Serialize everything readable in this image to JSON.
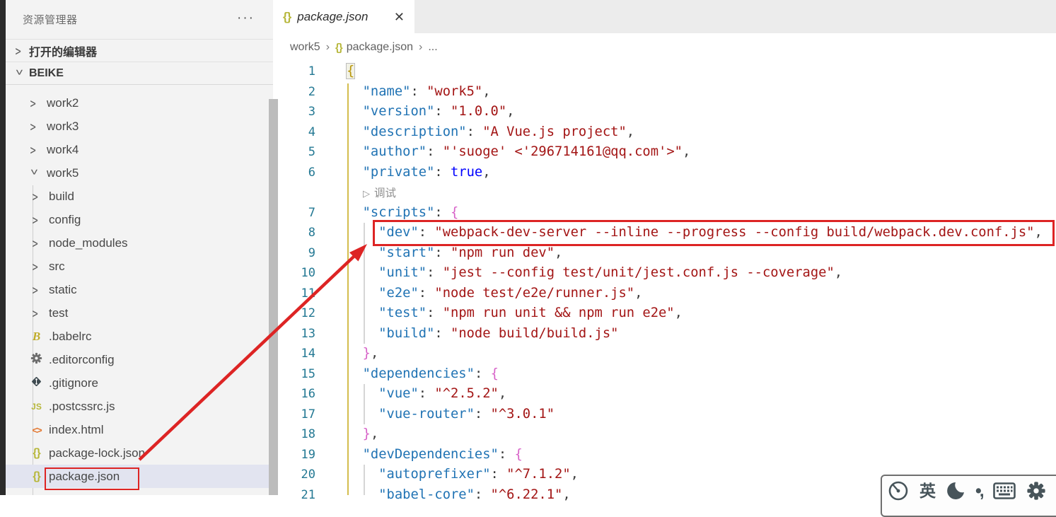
{
  "sidebar": {
    "title": "资源管理器",
    "more_actions": "···",
    "sections": [
      {
        "label": "打开的编辑器",
        "expanded": false
      },
      {
        "label": "BEIKE",
        "expanded": true
      }
    ],
    "tree": [
      {
        "label": "work2",
        "kind": "folder",
        "level": 1,
        "expanded": false
      },
      {
        "label": "work3",
        "kind": "folder",
        "level": 1,
        "expanded": false
      },
      {
        "label": "work4",
        "kind": "folder",
        "level": 1,
        "expanded": false
      },
      {
        "label": "work5",
        "kind": "folder",
        "level": 1,
        "expanded": true
      },
      {
        "label": "build",
        "kind": "folder",
        "level": 2,
        "expanded": false
      },
      {
        "label": "config",
        "kind": "folder",
        "level": 2,
        "expanded": false
      },
      {
        "label": "node_modules",
        "kind": "folder",
        "level": 2,
        "expanded": false
      },
      {
        "label": "src",
        "kind": "folder",
        "level": 2,
        "expanded": false
      },
      {
        "label": "static",
        "kind": "folder",
        "level": 2,
        "expanded": false
      },
      {
        "label": "test",
        "kind": "folder",
        "level": 2,
        "expanded": false
      },
      {
        "label": ".babelrc",
        "kind": "file",
        "icon": "babel-icon",
        "level": 2
      },
      {
        "label": ".editorconfig",
        "kind": "file",
        "icon": "gear-file-icon",
        "level": 2
      },
      {
        "label": ".gitignore",
        "kind": "file",
        "icon": "git-icon",
        "level": 2
      },
      {
        "label": ".postcssrc.js",
        "kind": "file",
        "icon": "js-icon",
        "level": 2
      },
      {
        "label": "index.html",
        "kind": "file",
        "icon": "html-icon",
        "level": 2
      },
      {
        "label": "package-lock.json",
        "kind": "file",
        "icon": "json-icon",
        "level": 2
      },
      {
        "label": "package.json",
        "kind": "file",
        "icon": "json-icon",
        "level": 2,
        "selected": true,
        "annotated": true
      }
    ]
  },
  "editor": {
    "tab": {
      "label": "package.json",
      "close_glyph": "✕"
    },
    "breadcrumb": {
      "root": "work5",
      "file": "package.json",
      "more": "...",
      "separator": "›"
    },
    "codelens": {
      "glyph": "▷",
      "label": "调试"
    },
    "code_lines": [
      {
        "num": "1",
        "tokens": [
          {
            "t": "b1",
            "v": "{",
            "match": true
          }
        ]
      },
      {
        "num": "2",
        "tokens": [
          {
            "t": "ws",
            "v": "  "
          },
          {
            "t": "k",
            "v": "\"name\""
          },
          {
            "t": "p",
            "v": ": "
          },
          {
            "t": "s",
            "v": "\"work5\""
          },
          {
            "t": "p",
            "v": ","
          }
        ]
      },
      {
        "num": "3",
        "tokens": [
          {
            "t": "ws",
            "v": "  "
          },
          {
            "t": "k",
            "v": "\"version\""
          },
          {
            "t": "p",
            "v": ": "
          },
          {
            "t": "s",
            "v": "\"1.0.0\""
          },
          {
            "t": "p",
            "v": ","
          }
        ]
      },
      {
        "num": "4",
        "tokens": [
          {
            "t": "ws",
            "v": "  "
          },
          {
            "t": "k",
            "v": "\"description\""
          },
          {
            "t": "p",
            "v": ": "
          },
          {
            "t": "s",
            "v": "\"A Vue.js project\""
          },
          {
            "t": "p",
            "v": ","
          }
        ]
      },
      {
        "num": "5",
        "tokens": [
          {
            "t": "ws",
            "v": "  "
          },
          {
            "t": "k",
            "v": "\"author\""
          },
          {
            "t": "p",
            "v": ": "
          },
          {
            "t": "s",
            "v": "\"'suoge' <'296714161@qq.com'>\""
          },
          {
            "t": "p",
            "v": ","
          }
        ]
      },
      {
        "num": "6",
        "tokens": [
          {
            "t": "ws",
            "v": "  "
          },
          {
            "t": "k",
            "v": "\"private\""
          },
          {
            "t": "p",
            "v": ": "
          },
          {
            "t": "kw",
            "v": "true"
          },
          {
            "t": "p",
            "v": ","
          }
        ]
      },
      {
        "codelens": true
      },
      {
        "num": "7",
        "tokens": [
          {
            "t": "ws",
            "v": "  "
          },
          {
            "t": "k",
            "v": "\"scripts\""
          },
          {
            "t": "p",
            "v": ": "
          },
          {
            "t": "b2",
            "v": "{"
          }
        ]
      },
      {
        "num": "8",
        "boxed": true,
        "tokens": [
          {
            "t": "ws",
            "v": "    "
          },
          {
            "t": "k",
            "v": "\"dev\""
          },
          {
            "t": "p",
            "v": ": "
          },
          {
            "t": "s",
            "v": "\"webpack-dev-server --inline --progress --config build/webpack.dev.conf.js\""
          },
          {
            "t": "p",
            "v": ","
          }
        ]
      },
      {
        "num": "9",
        "tokens": [
          {
            "t": "ws",
            "v": "    "
          },
          {
            "t": "k",
            "v": "\"start\""
          },
          {
            "t": "p",
            "v": ": "
          },
          {
            "t": "s",
            "v": "\"npm run dev\""
          },
          {
            "t": "p",
            "v": ","
          }
        ]
      },
      {
        "num": "10",
        "tokens": [
          {
            "t": "ws",
            "v": "    "
          },
          {
            "t": "k",
            "v": "\"unit\""
          },
          {
            "t": "p",
            "v": ": "
          },
          {
            "t": "s",
            "v": "\"jest --config test/unit/jest.conf.js --coverage\""
          },
          {
            "t": "p",
            "v": ","
          }
        ]
      },
      {
        "num": "11",
        "tokens": [
          {
            "t": "ws",
            "v": "    "
          },
          {
            "t": "k",
            "v": "\"e2e\""
          },
          {
            "t": "p",
            "v": ": "
          },
          {
            "t": "s",
            "v": "\"node test/e2e/runner.js\""
          },
          {
            "t": "p",
            "v": ","
          }
        ]
      },
      {
        "num": "12",
        "tokens": [
          {
            "t": "ws",
            "v": "    "
          },
          {
            "t": "k",
            "v": "\"test\""
          },
          {
            "t": "p",
            "v": ": "
          },
          {
            "t": "s",
            "v": "\"npm run unit && npm run e2e\""
          },
          {
            "t": "p",
            "v": ","
          }
        ]
      },
      {
        "num": "13",
        "tokens": [
          {
            "t": "ws",
            "v": "    "
          },
          {
            "t": "k",
            "v": "\"build\""
          },
          {
            "t": "p",
            "v": ": "
          },
          {
            "t": "s",
            "v": "\"node build/build.js\""
          }
        ]
      },
      {
        "num": "14",
        "tokens": [
          {
            "t": "ws",
            "v": "  "
          },
          {
            "t": "b2",
            "v": "}"
          },
          {
            "t": "p",
            "v": ","
          }
        ]
      },
      {
        "num": "15",
        "tokens": [
          {
            "t": "ws",
            "v": "  "
          },
          {
            "t": "k",
            "v": "\"dependencies\""
          },
          {
            "t": "p",
            "v": ": "
          },
          {
            "t": "b2",
            "v": "{"
          }
        ]
      },
      {
        "num": "16",
        "tokens": [
          {
            "t": "ws",
            "v": "    "
          },
          {
            "t": "k",
            "v": "\"vue\""
          },
          {
            "t": "p",
            "v": ": "
          },
          {
            "t": "s",
            "v": "\"^2.5.2\""
          },
          {
            "t": "p",
            "v": ","
          }
        ]
      },
      {
        "num": "17",
        "tokens": [
          {
            "t": "ws",
            "v": "    "
          },
          {
            "t": "k",
            "v": "\"vue-router\""
          },
          {
            "t": "p",
            "v": ": "
          },
          {
            "t": "s",
            "v": "\"^3.0.1\""
          }
        ]
      },
      {
        "num": "18",
        "tokens": [
          {
            "t": "ws",
            "v": "  "
          },
          {
            "t": "b2",
            "v": "}"
          },
          {
            "t": "p",
            "v": ","
          }
        ]
      },
      {
        "num": "19",
        "tokens": [
          {
            "t": "ws",
            "v": "  "
          },
          {
            "t": "k",
            "v": "\"devDependencies\""
          },
          {
            "t": "p",
            "v": ": "
          },
          {
            "t": "b2",
            "v": "{"
          }
        ]
      },
      {
        "num": "20",
        "tokens": [
          {
            "t": "ws",
            "v": "    "
          },
          {
            "t": "k",
            "v": "\"autoprefixer\""
          },
          {
            "t": "p",
            "v": ": "
          },
          {
            "t": "s",
            "v": "\"^7.1.2\""
          },
          {
            "t": "p",
            "v": ","
          }
        ]
      },
      {
        "num": "21",
        "tokens": [
          {
            "t": "ws",
            "v": "    "
          },
          {
            "t": "k",
            "v": "\"babel-core\""
          },
          {
            "t": "p",
            "v": ": "
          },
          {
            "t": "s",
            "v": "\"^6.22.1\""
          },
          {
            "t": "p",
            "v": ","
          }
        ]
      }
    ]
  },
  "ime_toolbar": {
    "lang_label": "英",
    "punct_label": "•,"
  },
  "annotation_colors": {
    "red": "#dd2424"
  }
}
